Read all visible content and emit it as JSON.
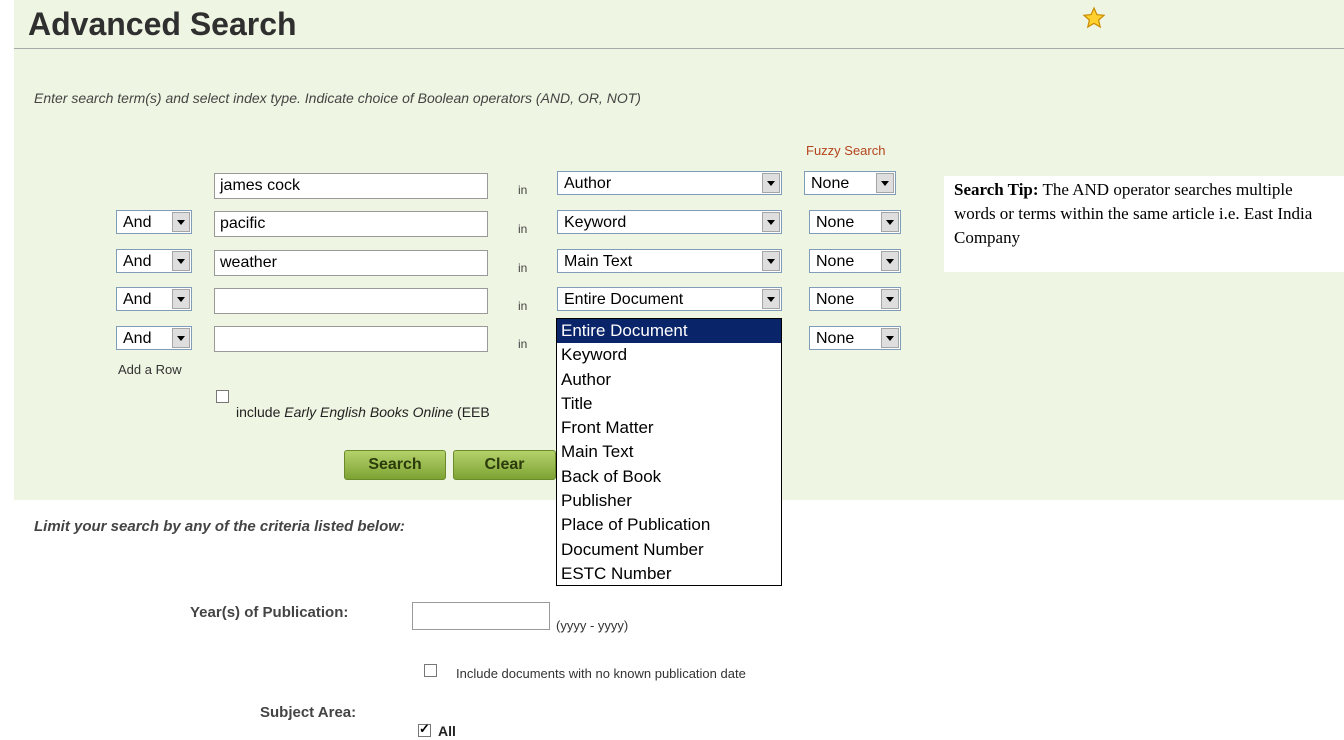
{
  "header": {
    "title": "Advanced Search",
    "favorite_icon": "star-icon"
  },
  "instructions": "Enter search term(s) and select index type. Indicate choice of Boolean operators (AND, OR, NOT)",
  "fuzzy_label": "Fuzzy Search",
  "in_label": "in",
  "rows": [
    {
      "operator": null,
      "term": "james cock",
      "index": "Author",
      "fuzzy": "None"
    },
    {
      "operator": "And",
      "term": "pacific",
      "index": "Keyword",
      "fuzzy": "None"
    },
    {
      "operator": "And",
      "term": "weather",
      "index": "Main Text",
      "fuzzy": "None"
    },
    {
      "operator": "And",
      "term": "",
      "index": "Entire Document",
      "fuzzy": "None"
    },
    {
      "operator": "And",
      "term": "",
      "index": "",
      "fuzzy": "None"
    }
  ],
  "add_row_label": "Add a Row",
  "eebo": {
    "prefix": "include ",
    "italic": "Early English Books Online",
    "suffix": " (EEB"
  },
  "buttons": {
    "search": "Search",
    "clear": "Clear"
  },
  "search_tip": {
    "bold": "Search Tip:",
    "text": " The AND operator searches multiple words or terms within the same article i.e. East India Company"
  },
  "index_dropdown": {
    "selected": "Entire Document",
    "options": [
      "Entire Document",
      "Keyword",
      "Author",
      "Title",
      "Front Matter",
      "Main Text",
      "Back of Book",
      "Publisher",
      "Place of Publication",
      "Document Number",
      "ESTC Number"
    ]
  },
  "limits": {
    "heading": "Limit your search by any of the criteria listed below:",
    "year_label": "Year(s) of Publication:",
    "year_value": "",
    "year_hint": "(yyyy - yyyy)",
    "no_date_label": "Include documents with no known publication date",
    "subject_label": "Subject Area:",
    "subject_all_label": "All",
    "subject_all_checked": true
  },
  "colors": {
    "panel_bg": "#eef5e2",
    "fuzzy_label": "#b5441e",
    "highlight": "#0a246a"
  }
}
